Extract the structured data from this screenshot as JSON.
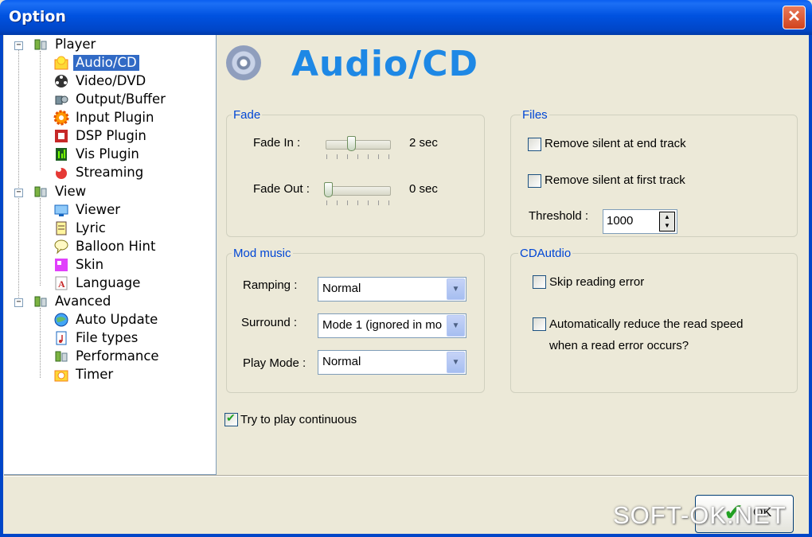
{
  "window": {
    "title": "Option",
    "close_glyph": "✕"
  },
  "tree": {
    "groups": [
      {
        "label": "Player",
        "expander": "−",
        "items": [
          "Audio/CD",
          "Video/DVD",
          "Output/Buffer",
          "Input Plugin",
          "DSP Plugin",
          "Vis Plugin",
          "Streaming"
        ]
      },
      {
        "label": "View",
        "expander": "−",
        "items": [
          "Viewer",
          "Lyric",
          "Balloon Hint",
          "Skin",
          "Language"
        ]
      },
      {
        "label": "Avanced",
        "expander": "−",
        "items": [
          "Auto Update",
          "File types",
          "Performance",
          "Timer"
        ]
      }
    ],
    "selected": "Audio/CD"
  },
  "page": {
    "title": "Audio/CD",
    "icon": "cd-icon"
  },
  "fade": {
    "label": "Fade",
    "fade_in": {
      "label": "Fade In :",
      "value": "2 sec"
    },
    "fade_out": {
      "label": "Fade Out :",
      "value": "0 sec"
    }
  },
  "files": {
    "label": "Files",
    "remove_end": {
      "label": "Remove silent at end track",
      "checked": false
    },
    "remove_first": {
      "label": "Remove silent at first track",
      "checked": false
    },
    "threshold": {
      "label": "Threshold :",
      "value": "1000"
    }
  },
  "mod": {
    "label": "Mod music",
    "ramping": {
      "label": "Ramping :",
      "value": "Normal"
    },
    "surround": {
      "label": "Surround :",
      "value": "Mode 1 (ignored in mo"
    },
    "play_mode": {
      "label": "Play Mode :",
      "value": "Normal"
    }
  },
  "cdaudio": {
    "label": "CDAutdio",
    "skip": {
      "label": "Skip reading error",
      "checked": false
    },
    "reduce": {
      "label_line1": "Automatically reduce the read speed",
      "label_line2": "when a read error occurs?",
      "checked": false
    }
  },
  "continuous": {
    "label": "Try to play continuous",
    "checked": true
  },
  "ok": {
    "label": "OK"
  },
  "watermark": "SOFT-OK.NET",
  "colors": {
    "accent": "#1e88e5",
    "titlebar": "#0052e0",
    "selection": "#316ac5",
    "group_label": "#0046d5"
  }
}
